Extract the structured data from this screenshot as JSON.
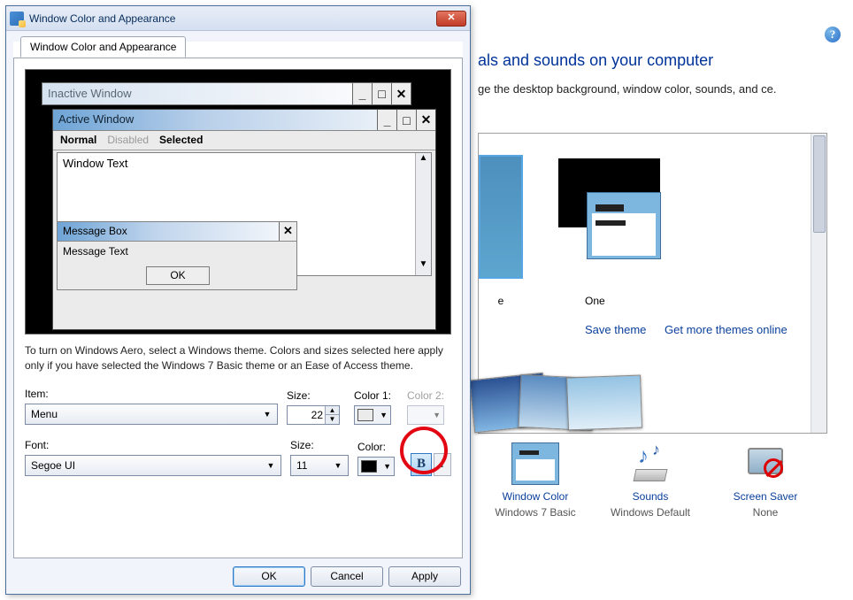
{
  "dialog": {
    "title": "Window Color and Appearance",
    "tab": "Window Color and Appearance",
    "preview": {
      "inactive": "Inactive Window",
      "active": "Active Window",
      "menu_normal": "Normal",
      "menu_disabled": "Disabled",
      "menu_selected": "Selected",
      "window_text": "Window Text",
      "msgbox_title": "Message Box",
      "msgbox_text": "Message Text",
      "ok": "OK"
    },
    "info": "To turn on Windows Aero, select a Windows theme.  Colors and sizes selected here apply only if you have selected the Windows 7 Basic theme or an Ease of Access theme.",
    "item_label": "Item:",
    "item_value": "Menu",
    "size1_label": "Size:",
    "size1_value": "22",
    "color1_label": "Color 1:",
    "color1_value": "#ebebeb",
    "color2_label": "Color 2:",
    "font_label": "Font:",
    "font_value": "Segoe UI",
    "size2_label": "Size:",
    "size2_value": "11",
    "fcolor_label": "Color:",
    "fcolor_value": "#000000",
    "bold": "B",
    "italic": "I",
    "ok": "OK",
    "cancel": "Cancel",
    "apply": "Apply"
  },
  "cp": {
    "heading": "als and sounds on your computer",
    "sub": "ge the desktop background, window color, sounds, and ce.",
    "sel_label": "e",
    "one_label": "One",
    "save": "Save theme",
    "more": "Get more themes online",
    "wc": "Window Color",
    "wc_sub": "Windows 7 Basic",
    "sd": "Sounds",
    "sd_sub": "Windows Default",
    "sv": "Screen Saver",
    "sv_sub": "None"
  }
}
